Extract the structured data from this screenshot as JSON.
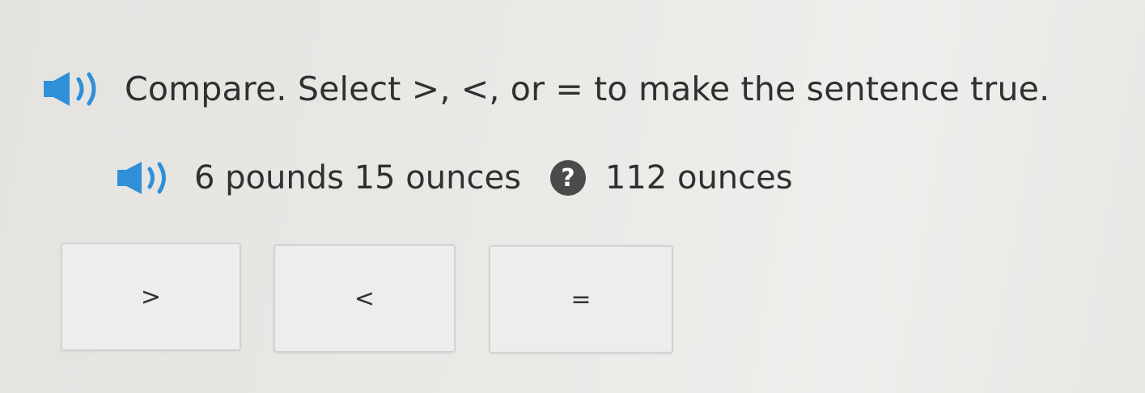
{
  "prompt": {
    "text": "Compare. Select >, <, or = to make the sentence true."
  },
  "problem": {
    "left_quantity": "6 pounds 15 ounces",
    "comparison_placeholder": "?",
    "right_quantity": "112 ounces"
  },
  "choices": [
    {
      "label": ">"
    },
    {
      "label": "<"
    },
    {
      "label": "="
    }
  ],
  "colors": {
    "speaker_accent": "#2f8fd8",
    "placeholder_circle": "#4b4b4b"
  },
  "icons": {
    "prompt_audio": "speaker-icon",
    "problem_audio": "speaker-icon"
  }
}
